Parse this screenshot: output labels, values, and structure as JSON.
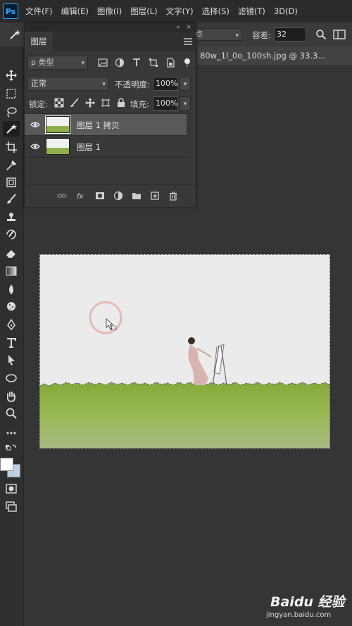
{
  "app": {
    "logo": "Ps",
    "menu": [
      "文件(F)",
      "编辑(E)",
      "图像(I)",
      "图层(L)",
      "文字(Y)",
      "选择(S)",
      "滤镜(T)",
      "3D(D)"
    ]
  },
  "options_bar": {
    "tool_icon": "magic-wand-icon",
    "select_value_partial": "点",
    "tolerance_label": "容差:",
    "tolerance_value": "32"
  },
  "document": {
    "tab_title": "80w_1l_0o_100sh.jpg @ 33.3..."
  },
  "layers_panel": {
    "tab_label": "图层",
    "collapse_glyph": "«",
    "close_glyph": "×",
    "filter_label": "ρ 类型",
    "blend_mode": "正常",
    "opacity_label": "不透明度:",
    "opacity_value": "100%",
    "lock_label": "锁定:",
    "fill_label": "填充:",
    "fill_value": "100%",
    "layers": [
      {
        "name": "图层 1 拷贝",
        "visible": true,
        "selected": true
      },
      {
        "name": "图层 1",
        "visible": true,
        "selected": false
      }
    ],
    "footer_icons": [
      "link-icon",
      "fx-icon",
      "mask-icon",
      "adjustment-icon",
      "group-folder-icon",
      "new-layer-icon",
      "trash-icon"
    ]
  },
  "toolbar": {
    "tools": [
      "move-icon",
      "marquee-icon",
      "lasso-icon",
      "magic-wand-icon",
      "crop-icon",
      "eyedropper-icon",
      "frame-icon",
      "brush-icon",
      "stamp-icon",
      "history-brush-icon",
      "eraser-icon",
      "gradient-icon",
      "blur-drop-icon",
      "sponge-icon",
      "pen-icon",
      "type-icon",
      "path-select-icon",
      "ellipse-icon",
      "hand-icon",
      "zoom-icon",
      "more-icon",
      "swap-colors-icon",
      "color-swatches-icon",
      "quick-mask-icon",
      "screen-mode-icon"
    ]
  },
  "watermark": {
    "logo": "Baidu 经验",
    "domain": "jingyan.baidu.com"
  }
}
